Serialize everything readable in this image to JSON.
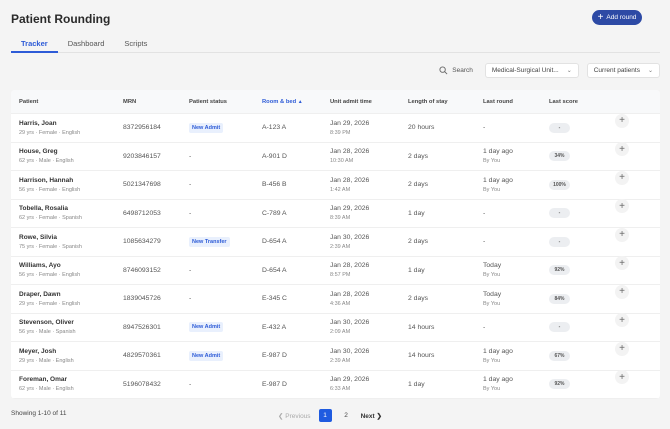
{
  "header": {
    "title": "Patient Rounding",
    "add_round": "Add round"
  },
  "tabs": [
    {
      "label": "Tracker",
      "active": true
    },
    {
      "label": "Dashboard"
    },
    {
      "label": "Scripts"
    }
  ],
  "filters": {
    "search": "Search",
    "unit": "Medical-Surgical Unit...",
    "patients": "Current patients"
  },
  "table": {
    "columns": [
      "Patient",
      "MRN",
      "Patient status",
      "Room & bed",
      "Unit admit time",
      "Length of stay",
      "Last round",
      "Last score"
    ],
    "sorted_column": "Room & bed",
    "rows": [
      {
        "name": "Harris, Joan",
        "info": "29 yrs · Female · English",
        "mrn": "8372956184",
        "status": "New Admit",
        "room": "A-123 A",
        "admit_date": "Jan 29, 2026",
        "admit_time": "8:39 PM",
        "los": "20 hours",
        "last_round": "-",
        "by": "",
        "score": "-"
      },
      {
        "name": "House, Greg",
        "info": "62 yrs · Male · English",
        "mrn": "9203846157",
        "status": "-",
        "room": "A-901 D",
        "admit_date": "Jan 28, 2026",
        "admit_time": "10:30 AM",
        "los": "2 days",
        "last_round": "1 day ago",
        "by": "By You",
        "score": "34%"
      },
      {
        "name": "Harrison, Hannah",
        "info": "56 yrs · Female · English",
        "mrn": "5021347698",
        "status": "-",
        "room": "B-456 B",
        "admit_date": "Jan 28, 2026",
        "admit_time": "1:42 AM",
        "los": "2 days",
        "last_round": "1 day ago",
        "by": "By You",
        "score": "100%"
      },
      {
        "name": "Tobella, Rosalia",
        "info": "62 yrs · Female · Spanish",
        "mrn": "6498712053",
        "status": "-",
        "room": "C-789 A",
        "admit_date": "Jan 29, 2026",
        "admit_time": "8:39 AM",
        "los": "1 day",
        "last_round": "-",
        "by": "",
        "score": "-"
      },
      {
        "name": "Rowe, Silvia",
        "info": "75 yrs · Female · Spanish",
        "mrn": "1085634279",
        "status": "New Transfer",
        "room": "D-654 A",
        "admit_date": "Jan 30, 2026",
        "admit_time": "2:39 AM",
        "los": "2 days",
        "last_round": "-",
        "by": "",
        "score": "-"
      },
      {
        "name": "Williams, Ayo",
        "info": "56 yrs · Female · English",
        "mrn": "8746093152",
        "status": "-",
        "room": "D-654 A",
        "admit_date": "Jan 28, 2026",
        "admit_time": "8:57 PM",
        "los": "1 day",
        "last_round": "Today",
        "by": "By You",
        "score": "92%"
      },
      {
        "name": "Draper, Dawn",
        "info": "29 yrs · Female · English",
        "mrn": "1839045726",
        "status": "-",
        "room": "E-345 C",
        "admit_date": "Jan 28, 2026",
        "admit_time": "4:36 AM",
        "los": "2 days",
        "last_round": "Today",
        "by": "By You",
        "score": "84%"
      },
      {
        "name": "Stevenson, Oliver",
        "info": "56 yrs · Male · Spanish",
        "mrn": "8947526301",
        "status": "New Admit",
        "room": "E-432 A",
        "admit_date": "Jan 30, 2026",
        "admit_time": "2:09 AM",
        "los": "14 hours",
        "last_round": "-",
        "by": "",
        "score": "-"
      },
      {
        "name": "Meyer, Josh",
        "info": "29 yrs · Male · English",
        "mrn": "4829570361",
        "status": "New Admit",
        "room": "E-987 D",
        "admit_date": "Jan 30, 2026",
        "admit_time": "2:39 AM",
        "los": "14 hours",
        "last_round": "1 day ago",
        "by": "By You",
        "score": "67%"
      },
      {
        "name": "Foreman, Omar",
        "info": "62 yrs · Male · English",
        "mrn": "5196078432",
        "status": "-",
        "room": "E-987 D",
        "admit_date": "Jan 29, 2026",
        "admit_time": "6:33 AM",
        "los": "1 day",
        "last_round": "1 day ago",
        "by": "By You",
        "score": "92%"
      }
    ]
  },
  "footer": {
    "showing": "Showing 1-10 of 11",
    "previous": "Previous",
    "pages": [
      "1",
      "2"
    ],
    "current_page": "1",
    "next": "Next"
  }
}
